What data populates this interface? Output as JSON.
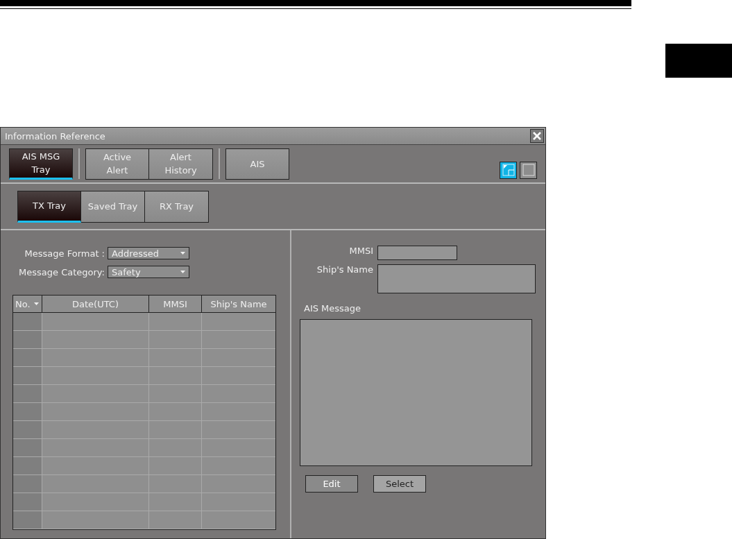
{
  "window": {
    "title": "Information Reference"
  },
  "main_tabs": [
    {
      "label": "AIS MSG Tray",
      "separator_before": false,
      "selected": true
    },
    {
      "label": "Active Alert",
      "separator_before": true,
      "selected": false
    },
    {
      "label": "Alert History",
      "separator_before": false,
      "selected": false
    },
    {
      "label": "AIS",
      "separator_before": true,
      "selected": false
    }
  ],
  "layout_buttons": [
    {
      "kind": "split",
      "selected": true
    },
    {
      "kind": "single",
      "selected": false
    }
  ],
  "sub_tabs": [
    {
      "label": "TX Tray",
      "selected": true
    },
    {
      "label": "Saved Tray",
      "selected": false
    },
    {
      "label": "RX Tray",
      "selected": false
    }
  ],
  "filters": [
    {
      "label": "Message Format :",
      "value": "Addressed"
    },
    {
      "label": "Message Category:",
      "value": "Safety"
    }
  ],
  "table": {
    "columns": [
      "No.",
      "Date(UTC)",
      "MMSI",
      "Ship's Name"
    ],
    "rows": [
      {
        "selected": false
      },
      {
        "selected": false
      },
      {
        "selected": false
      },
      {
        "selected": false
      },
      {
        "selected": false
      },
      {
        "selected": false
      },
      {
        "selected": false
      },
      {
        "selected": false
      },
      {
        "selected": false
      },
      {
        "selected": false
      },
      {
        "selected": false
      },
      {
        "selected": false
      }
    ]
  },
  "details": {
    "mmsi_label": "MMSI",
    "ship_name_label": "Ship's Name",
    "message_label": "AIS Message"
  },
  "buttons": [
    {
      "label": "Edit",
      "kind": "dark"
    },
    {
      "label": "Select",
      "kind": "light"
    }
  ]
}
